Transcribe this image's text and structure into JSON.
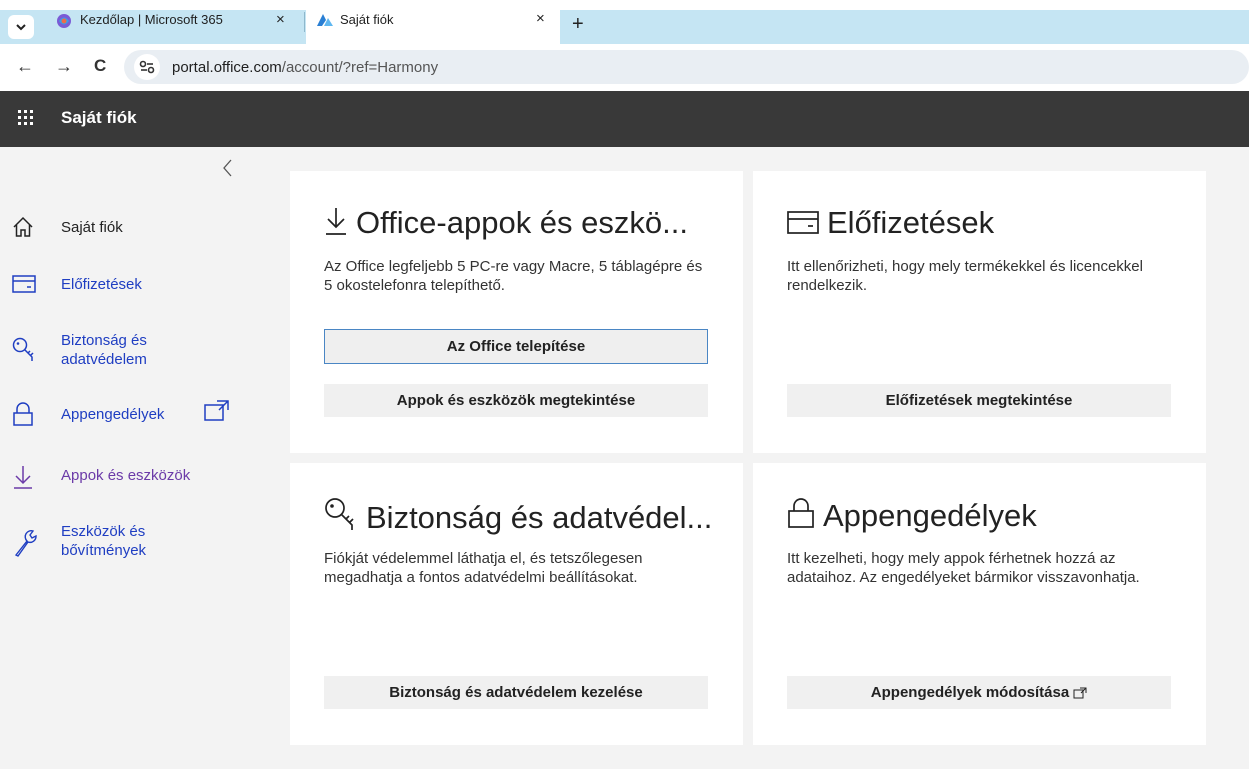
{
  "browser": {
    "tabs": [
      {
        "title": "Kezdőlap | Microsoft 365",
        "icon": "microsoft365-icon",
        "active": false
      },
      {
        "title": "Saját fiók",
        "icon": "account-icon",
        "active": true
      }
    ],
    "close_glyph": "×",
    "new_tab_glyph": "+",
    "url_domain": "portal.office.com",
    "url_path": "/account/?ref=Harmony",
    "nav_glyphs": {
      "back": "←",
      "forward": "→",
      "reload": "C"
    }
  },
  "header": {
    "title": "Saját fiók",
    "bg_color": "#393939"
  },
  "sidebar": {
    "collapse_glyph": "‹",
    "items": [
      {
        "label": "Saját fiók",
        "icon": "home-icon"
      },
      {
        "label": "Előfizetések",
        "icon": "card-icon"
      },
      {
        "label": "Biztonság és adatvédelem",
        "icon": "key-icon"
      },
      {
        "label": "Appengedélyek",
        "icon": "lock-icon",
        "external": true
      },
      {
        "label": "Appok és eszközök",
        "icon": "download-icon"
      },
      {
        "label": "Eszközök és bővítmények",
        "icon": "wrench-icon"
      }
    ]
  },
  "cards": {
    "office_apps": {
      "title": "Office-appok és eszkö...",
      "desc": "Az Office legfeljebb 5 PC-re vagy Macre, 5 táblagépre és 5 okostelefonra telepíthető.",
      "primary_button": "Az Office telepítése",
      "secondary_button": "Appok és eszközök megtekintése"
    },
    "subscriptions": {
      "title": "Előfizetések",
      "desc": "Itt ellenőrizheti, hogy mely termékekkel és licencekkel rendelkezik.",
      "button": "Előfizetések megtekintése"
    },
    "security": {
      "title": "Biztonság és adatvédel...",
      "desc": "Fiókját védelemmel láthatja el, és tetszőlegesen megadhatja a fontos adatvédelmi beállításokat.",
      "button": "Biztonság és adatvédelem kezelése"
    },
    "app_permissions": {
      "title": "Appengedélyek",
      "desc": "Itt kezelheti, hogy mely appok férhetnek hozzá az adataihoz. Az engedélyeket bármikor visszavonhatja.",
      "button": "Appengedélyek módosítása"
    }
  },
  "colors": {
    "link_blue": "#1f3ec2",
    "accent_border": "#4a86c4",
    "tab_bar": "#c5e5f3"
  }
}
